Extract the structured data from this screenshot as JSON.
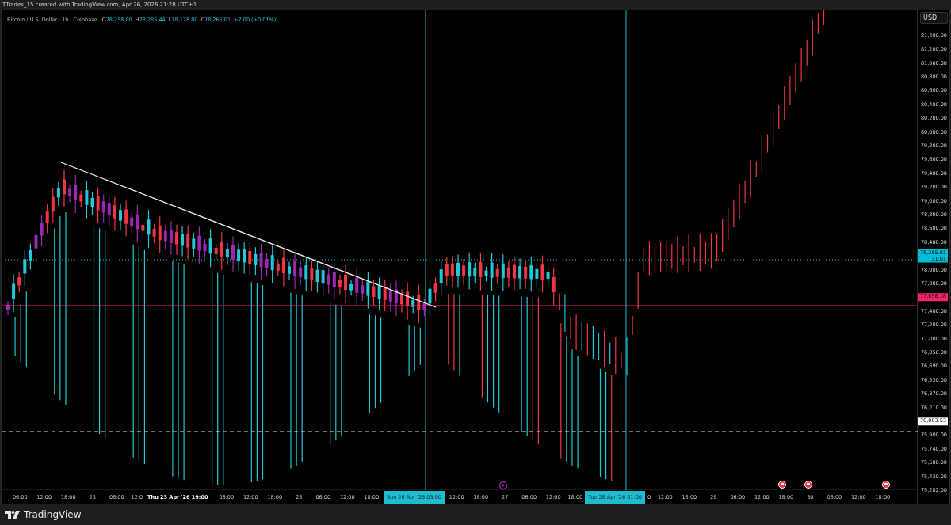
{
  "header": {
    "credit": "TTrades_15 created with TradingView.com, Apr 26, 2026 21:28 UTC+1"
  },
  "legend": {
    "symbol": "Bitcoin / U.S. Dollar · 1h · Coinbase",
    "ohlc": [
      {
        "label": "O",
        "value": "78,258.00"
      },
      {
        "label": "H",
        "value": "78,285.44"
      },
      {
        "label": "L",
        "value": "78,178.80"
      },
      {
        "label": "C",
        "value": "78,265.01"
      }
    ],
    "change": "+7.00 (+0.01%)"
  },
  "price_axis": {
    "currency": "USD",
    "labels": [
      {
        "kind": "tick",
        "text": "81,400.00"
      },
      {
        "kind": "tick",
        "text": "81,200.00"
      },
      {
        "kind": "tick",
        "text": "81,000.00"
      },
      {
        "kind": "tick",
        "text": "80,800.00"
      },
      {
        "kind": "tick",
        "text": "80,600.00"
      },
      {
        "kind": "tick",
        "text": "80,400.00"
      },
      {
        "kind": "tick",
        "text": "80,200.00"
      },
      {
        "kind": "tick",
        "text": "80,000.00"
      },
      {
        "kind": "tick",
        "text": "79,800.00"
      },
      {
        "kind": "tick",
        "text": "79,600.00"
      },
      {
        "kind": "tick",
        "text": "79,400.00"
      },
      {
        "kind": "tick",
        "text": "79,200.00"
      },
      {
        "kind": "tick",
        "text": "79,000.00"
      },
      {
        "kind": "tick",
        "text": "78,800.00"
      },
      {
        "kind": "tick",
        "text": "78,600.00"
      },
      {
        "kind": "tick",
        "text": "78,400.00"
      },
      {
        "kind": "badge",
        "text": "78,265.01",
        "subtext": "31:01",
        "color": "#00bcd4"
      },
      {
        "kind": "tick",
        "text": "78,000.00"
      },
      {
        "kind": "tick",
        "text": "77,800.00"
      },
      {
        "kind": "badge",
        "text": "77,656.16",
        "color": "#f7266b"
      },
      {
        "kind": "tick",
        "text": "77,400.00"
      },
      {
        "kind": "tick",
        "text": "77,200.00"
      },
      {
        "kind": "tick",
        "text": "77,000.00"
      },
      {
        "kind": "tick",
        "text": "76,850.00"
      },
      {
        "kind": "tick",
        "text": "76,690.00"
      },
      {
        "kind": "tick",
        "text": "76,530.00"
      },
      {
        "kind": "tick",
        "text": "76,370.00"
      },
      {
        "kind": "tick",
        "text": "76,210.00"
      },
      {
        "kind": "badge",
        "text": "76,003.53",
        "color": "#ffffff"
      },
      {
        "kind": "tick",
        "text": "75,900.00"
      },
      {
        "kind": "tick",
        "text": "75,740.00"
      },
      {
        "kind": "tick",
        "text": "75,580.00"
      },
      {
        "kind": "tick",
        "text": "75,430.00"
      },
      {
        "kind": "tick",
        "text": "75,282.00"
      }
    ]
  },
  "time_axis": {
    "labels": [
      {
        "kind": "tick",
        "text": "06:00"
      },
      {
        "kind": "tick",
        "text": "12:00"
      },
      {
        "kind": "tick",
        "text": "18:00"
      },
      {
        "kind": "tick",
        "text": "23"
      },
      {
        "kind": "tick",
        "text": "06:00"
      },
      {
        "kind": "cut",
        "text": "12:0"
      },
      {
        "kind": "crosshair",
        "text": "Thu 23 Apr '26",
        "time": "19:00"
      },
      {
        "kind": "tick",
        "text": "06:00"
      },
      {
        "kind": "tick",
        "text": "12:00"
      },
      {
        "kind": "tick",
        "text": "18:00"
      },
      {
        "kind": "tick",
        "text": "25"
      },
      {
        "kind": "tick",
        "text": "06:00"
      },
      {
        "kind": "tick",
        "text": "12:00"
      },
      {
        "kind": "tick",
        "text": "18:00"
      },
      {
        "kind": "badge",
        "text": "Sun 26 Apr '26",
        "time": "03:00"
      },
      {
        "kind": "tick",
        "text": "12:00"
      },
      {
        "kind": "tick",
        "text": "18:00"
      },
      {
        "kind": "tick",
        "text": "27"
      },
      {
        "kind": "tick",
        "text": "06:00"
      },
      {
        "kind": "tick",
        "text": "12:00"
      },
      {
        "kind": "cut",
        "text": "18:00"
      },
      {
        "kind": "badge",
        "text": "Tue 28 Apr '26",
        "time": "01:00"
      },
      {
        "kind": "cut",
        "text": "0"
      },
      {
        "kind": "tick",
        "text": "12:00"
      },
      {
        "kind": "tick",
        "text": "18:00"
      },
      {
        "kind": "tick",
        "text": "29"
      },
      {
        "kind": "tick",
        "text": "06:00"
      },
      {
        "kind": "tick",
        "text": "12:00"
      },
      {
        "kind": "tick",
        "text": "18:00"
      },
      {
        "kind": "tick",
        "text": "30"
      },
      {
        "kind": "tick",
        "text": "06:00"
      },
      {
        "kind": "tick",
        "text": "12:00"
      },
      {
        "kind": "tick",
        "text": "18:00"
      }
    ]
  },
  "footer": {
    "brand": "TradingView"
  }
}
